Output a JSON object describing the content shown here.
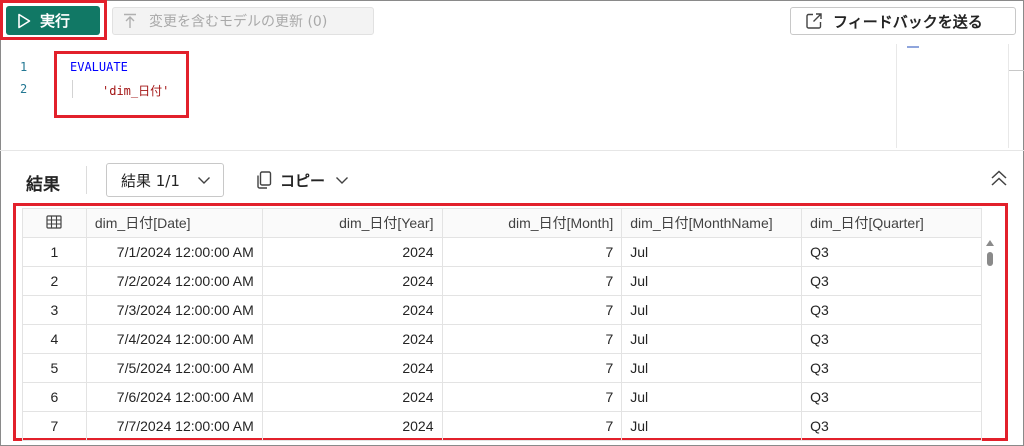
{
  "toolbar": {
    "run_label": "実行",
    "update_label": "変更を含むモデルの更新 (0)",
    "feedback_label": "フィードバックを送る"
  },
  "editor": {
    "lines": [
      {
        "number": "1",
        "text": "EVALUATE"
      },
      {
        "number": "2",
        "text": "'dim_日付'"
      }
    ]
  },
  "results": {
    "title": "結果",
    "selector_value": "結果 1/1",
    "copy_label": "コピー",
    "columns": [
      "dim_日付[Date]",
      "dim_日付[Year]",
      "dim_日付[Month]",
      "dim_日付[MonthName]",
      "dim_日付[Quarter]"
    ],
    "rows": [
      {
        "index": "1",
        "date": "7/1/2024 12:00:00 AM",
        "year": "2024",
        "month": "7",
        "month_name": "Jul",
        "quarter": "Q3"
      },
      {
        "index": "2",
        "date": "7/2/2024 12:00:00 AM",
        "year": "2024",
        "month": "7",
        "month_name": "Jul",
        "quarter": "Q3"
      },
      {
        "index": "3",
        "date": "7/3/2024 12:00:00 AM",
        "year": "2024",
        "month": "7",
        "month_name": "Jul",
        "quarter": "Q3"
      },
      {
        "index": "4",
        "date": "7/4/2024 12:00:00 AM",
        "year": "2024",
        "month": "7",
        "month_name": "Jul",
        "quarter": "Q3"
      },
      {
        "index": "5",
        "date": "7/5/2024 12:00:00 AM",
        "year": "2024",
        "month": "7",
        "month_name": "Jul",
        "quarter": "Q3"
      },
      {
        "index": "6",
        "date": "7/6/2024 12:00:00 AM",
        "year": "2024",
        "month": "7",
        "month_name": "Jul",
        "quarter": "Q3"
      },
      {
        "index": "7",
        "date": "7/7/2024 12:00:00 AM",
        "year": "2024",
        "month": "7",
        "month_name": "Jul",
        "quarter": "Q3"
      }
    ]
  },
  "colors": {
    "run_button": "#117865",
    "highlight": "#e2202b",
    "keyword": "#0000ff",
    "string": "#a31515",
    "line_number": "#237893"
  },
  "icons": {
    "run": "play-icon",
    "update": "arrow-up-icon",
    "feedback": "share-external-icon",
    "copy": "copy-icon",
    "collapse": "double-chevron-up-icon",
    "grid": "table-grid-icon"
  }
}
